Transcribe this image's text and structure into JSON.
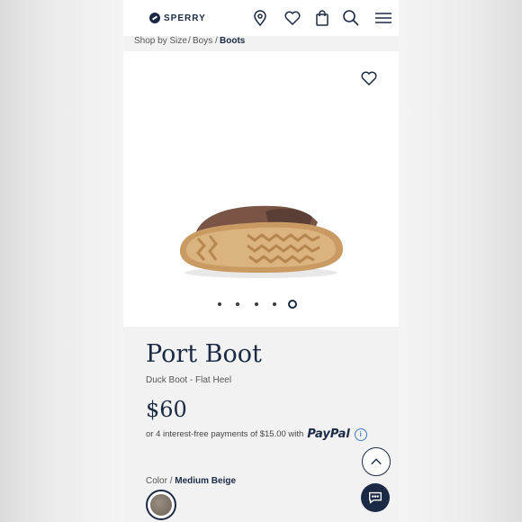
{
  "header": {
    "brand": "SPERRY",
    "icons": [
      "location-pin-icon",
      "heart-icon",
      "shopping-bag-icon",
      "search-icon",
      "menu-icon"
    ]
  },
  "breadcrumb": {
    "items": [
      "Shop by Size",
      "Boys",
      "Boots"
    ],
    "separator": "/"
  },
  "gallery": {
    "total_images": 5,
    "active_index": 4
  },
  "product": {
    "name": "Port Boot",
    "subtitle": "Duck Boot - Flat Heel",
    "price": "$60",
    "payment_text": "or 4 interest-free payments of $15.00 with",
    "payment_brand": "PayPal",
    "color_label": "Color",
    "color_separator": "/",
    "color_value": "Medium Beige"
  },
  "colors": {
    "navy": "#1b2a44",
    "accent_blue": "#3d7cc9"
  }
}
